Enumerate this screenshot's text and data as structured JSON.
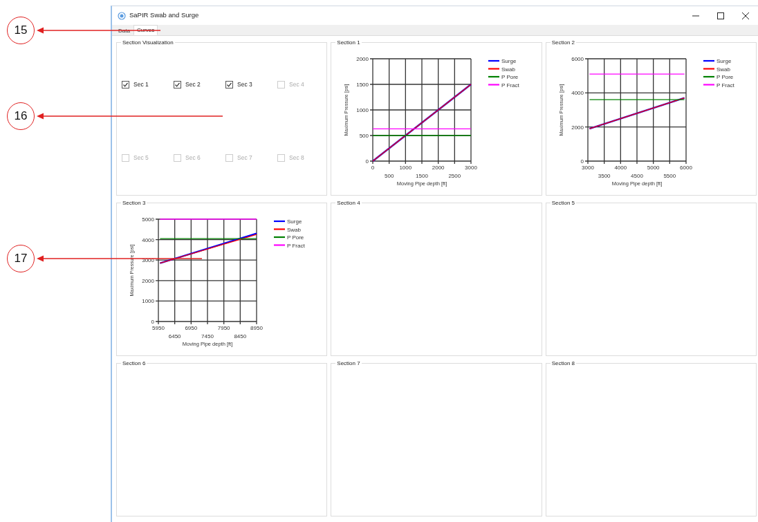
{
  "window": {
    "title": "SaPIR Swab and Surge"
  },
  "tabs": [
    {
      "label": "Data",
      "selected": false
    },
    {
      "label": "Curves",
      "selected": true
    }
  ],
  "visualization": {
    "title": "Section Visualization",
    "checkboxes": [
      {
        "label": "Sec 1",
        "checked": true,
        "disabled": false
      },
      {
        "label": "Sec 2",
        "checked": true,
        "disabled": false
      },
      {
        "label": "Sec 3",
        "checked": true,
        "disabled": false
      },
      {
        "label": "Sec 4",
        "checked": false,
        "disabled": true
      },
      {
        "label": "Sec 5",
        "checked": false,
        "disabled": true
      },
      {
        "label": "Sec 6",
        "checked": false,
        "disabled": true
      },
      {
        "label": "Sec 7",
        "checked": false,
        "disabled": true
      },
      {
        "label": "Sec 8",
        "checked": false,
        "disabled": true
      }
    ]
  },
  "sections": [
    {
      "title": "Section 1",
      "chart_data": {
        "type": "line",
        "xlabel": "Moving Pipe depth [ft]",
        "ylabel": "Maximum Pressure [psi]",
        "grid": true,
        "legend": true,
        "x": [
          0,
          3000
        ],
        "xlim": [
          0,
          3000
        ],
        "ylim": [
          0,
          2000
        ],
        "xticks": [
          0,
          1000,
          2000,
          3000
        ],
        "annotations": [
          "500",
          "1500",
          "2500"
        ],
        "yticks": [
          0,
          500,
          1000,
          1500,
          2000
        ],
        "series": [
          {
            "name": "Surge",
            "color": "#0000ff",
            "values": [
              0,
              1500
            ]
          },
          {
            "name": "Swab",
            "color": "#ff0000",
            "values": [
              0,
              1500
            ]
          },
          {
            "name": "P Pore",
            "color": "#008000",
            "values": [
              500,
              500
            ]
          },
          {
            "name": "P Fract",
            "color": "#ff00ff",
            "values": [
              630,
              630
            ]
          }
        ]
      }
    },
    {
      "title": "Section 2",
      "chart_data": {
        "type": "line",
        "xlabel": "Moving Pipe depth [ft]",
        "ylabel": "Maximum Pressure [psi]",
        "grid": true,
        "legend": true,
        "x": [
          3050,
          5950
        ],
        "xlim": [
          3000,
          6000
        ],
        "ylim": [
          0,
          6000
        ],
        "xticks": [
          3000,
          4000,
          5000,
          6000
        ],
        "annotations": [
          "3500",
          "4500",
          "5500"
        ],
        "yticks": [
          0,
          2000,
          4000,
          6000
        ],
        "series": [
          {
            "name": "Surge",
            "color": "#0000ff",
            "values": [
              1900,
              3700
            ]
          },
          {
            "name": "Swab",
            "color": "#ff0000",
            "values": [
              1900,
              3700
            ]
          },
          {
            "name": "P Pore",
            "color": "#008000",
            "values": [
              3600,
              3600
            ]
          },
          {
            "name": "P Fract",
            "color": "#ff00ff",
            "values": [
              5100,
              5100
            ]
          }
        ]
      }
    },
    {
      "title": "Section 3",
      "chart_data": {
        "type": "line",
        "xlabel": "Moving Pipe depth [ft]",
        "ylabel": "Maximum Pressure [psi]",
        "grid": true,
        "legend": true,
        "x": [
          6000,
          8950
        ],
        "xlim": [
          5950,
          8950
        ],
        "ylim": [
          0,
          5000
        ],
        "xticks": [
          5950,
          6950,
          7950,
          8950
        ],
        "annotations": [
          "6450",
          "7450",
          "8450"
        ],
        "yticks": [
          0,
          1000,
          2000,
          3000,
          4000,
          5000
        ],
        "series": [
          {
            "name": "Surge",
            "color": "#0000ff",
            "values": [
              2850,
              4300
            ]
          },
          {
            "name": "Swab",
            "color": "#ff0000",
            "values": [
              2850,
              4250
            ]
          },
          {
            "name": "P Pore",
            "color": "#008000",
            "values": [
              4050,
              4050
            ]
          },
          {
            "name": "P Fract",
            "color": "#ff00ff",
            "values": [
              5000,
              5000
            ]
          }
        ]
      }
    },
    {
      "title": "Section 4"
    },
    {
      "title": "Section 5"
    },
    {
      "title": "Section 6"
    },
    {
      "title": "Section 7"
    },
    {
      "title": "Section 8"
    }
  ],
  "callouts": [
    {
      "label": "15"
    },
    {
      "label": "16"
    },
    {
      "label": "17"
    }
  ]
}
